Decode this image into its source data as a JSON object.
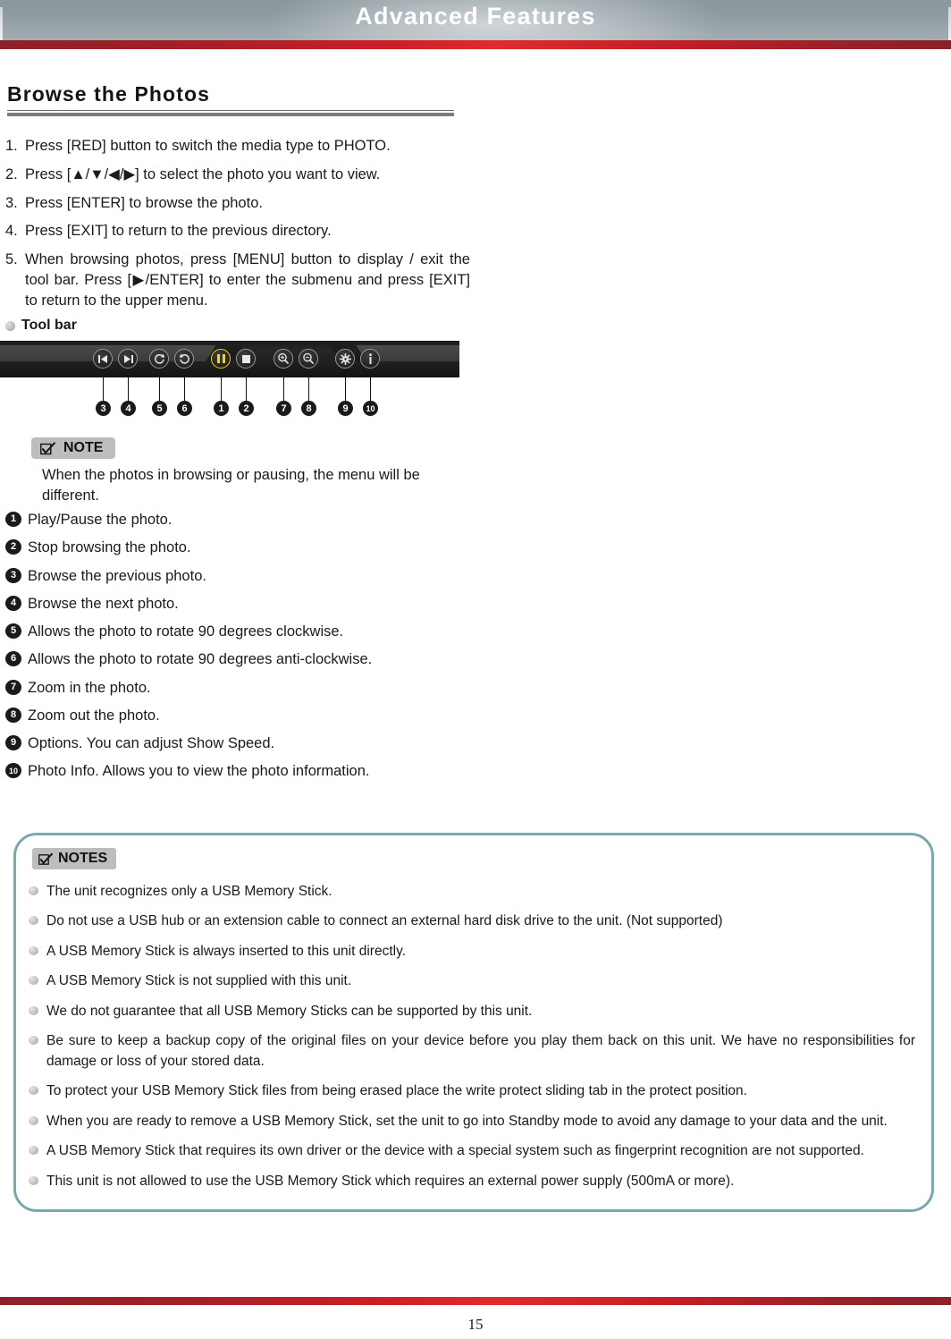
{
  "header": {
    "title": "Advanced Features",
    "accent_red": "#cf1f28",
    "bar_gray": "#8e9ba1"
  },
  "section": {
    "heading": "Browse the Photos"
  },
  "steps": [
    {
      "num": "1.",
      "text": "Press [RED] button to switch the media type to PHOTO."
    },
    {
      "num": "2.",
      "text": "Press [▲/▼/◀/▶] to select the photo you want to view."
    },
    {
      "num": "3.",
      "text": "Press [ENTER] to browse the photo."
    },
    {
      "num": "4.",
      "text": "Press [EXIT] to return to the previous directory."
    },
    {
      "num": "5.",
      "text": "When browsing photos, press [MENU] button to display / exit the tool bar. Press [▶/ENTER] to enter the submenu and press [EXIT] to return to the upper menu."
    }
  ],
  "toolbar": {
    "label": "Tool bar",
    "accent_color": "#f2d413",
    "icons": [
      {
        "name": "skip-previous-icon",
        "callout": "3"
      },
      {
        "name": "skip-next-icon",
        "callout": "4"
      },
      {
        "name": "rotate-clockwise-icon",
        "callout": "5"
      },
      {
        "name": "rotate-anticlockwise-icon",
        "callout": "6"
      },
      {
        "name": "pause-icon",
        "callout": "1"
      },
      {
        "name": "stop-icon",
        "callout": "2"
      },
      {
        "name": "zoom-in-icon",
        "callout": "7"
      },
      {
        "name": "zoom-out-icon",
        "callout": "8"
      },
      {
        "name": "options-gear-icon",
        "callout": "9"
      },
      {
        "name": "info-icon",
        "callout": "10"
      }
    ]
  },
  "note": {
    "tag": "NOTE",
    "body": "When the photos in browsing or pausing, the menu will be different."
  },
  "legend": [
    {
      "marker": "1",
      "text": "Play/Pause the photo."
    },
    {
      "marker": "2",
      "text": "Stop browsing the photo."
    },
    {
      "marker": "3",
      "text": "Browse the previous photo."
    },
    {
      "marker": "4",
      "text": "Browse the next photo."
    },
    {
      "marker": "5",
      "text": "Allows the photo to rotate 90 degrees clockwise."
    },
    {
      "marker": "6",
      "text": "Allows the photo to rotate 90 degrees anti-clockwise."
    },
    {
      "marker": "7",
      "text": "Zoom in the photo."
    },
    {
      "marker": "8",
      "text": "Zoom out the photo."
    },
    {
      "marker": "9",
      "text": "Options. You can adjust Show Speed."
    },
    {
      "marker": "10",
      "text": "Photo Info. Allows you to view the photo information."
    }
  ],
  "notes": {
    "tag": "NOTES",
    "border_color": "#77aab0",
    "items": [
      "The unit recognizes only a USB Memory Stick.",
      "Do not use a USB hub or an extension cable to connect an external hard disk drive to the unit. (Not supported)",
      "A USB Memory Stick is always inserted to this unit directly.",
      "A USB Memory Stick is not supplied with this unit.",
      "We do not guarantee that all USB Memory Sticks can be supported by this unit.",
      "Be sure to keep a backup copy of the original files on your device before you play them back on this unit. We have no responsibilities for damage or loss of your stored data.",
      "To protect your USB Memory Stick files from being erased place the write protect sliding tab in the protect position.",
      "When you are ready to remove a USB Memory Stick, set the unit to go into Standby mode to avoid any damage to your data and the unit.",
      "A USB Memory Stick that requires its own driver or the device with a special system such as fingerprint recognition are not supported.",
      "This unit is not allowed to use the USB Memory Stick which requires an external power supply (500mA or more)."
    ]
  },
  "footer": {
    "page_number": "15"
  }
}
